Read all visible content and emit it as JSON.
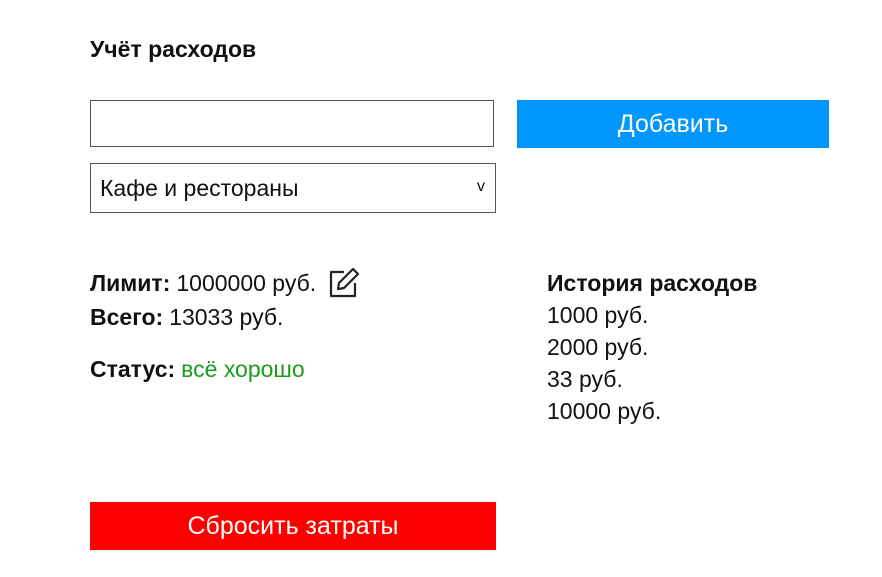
{
  "header": {
    "title": "Учёт расходов"
  },
  "form": {
    "amount_value": "",
    "amount_placeholder": "",
    "add_label": "Добавить",
    "category_selected": "Кафе и рестораны",
    "chevron_glyph": "v"
  },
  "stats": {
    "limit_label": "Лимит:",
    "limit_value": "1000000 руб.",
    "edit_icon": "edit-icon",
    "total_label": "Всего:",
    "total_value": "13033 руб.",
    "status_label": "Статус:",
    "status_value": "всё хорошо",
    "status_color": "#1e9b1e"
  },
  "history": {
    "title": "История расходов",
    "items": [
      "1000 руб.",
      "2000 руб.",
      "33 руб.",
      "10000 руб."
    ]
  },
  "actions": {
    "reset_label": "Сбросить затраты"
  },
  "colors": {
    "add_button": "#0096ff",
    "reset_button": "#ff0000"
  }
}
